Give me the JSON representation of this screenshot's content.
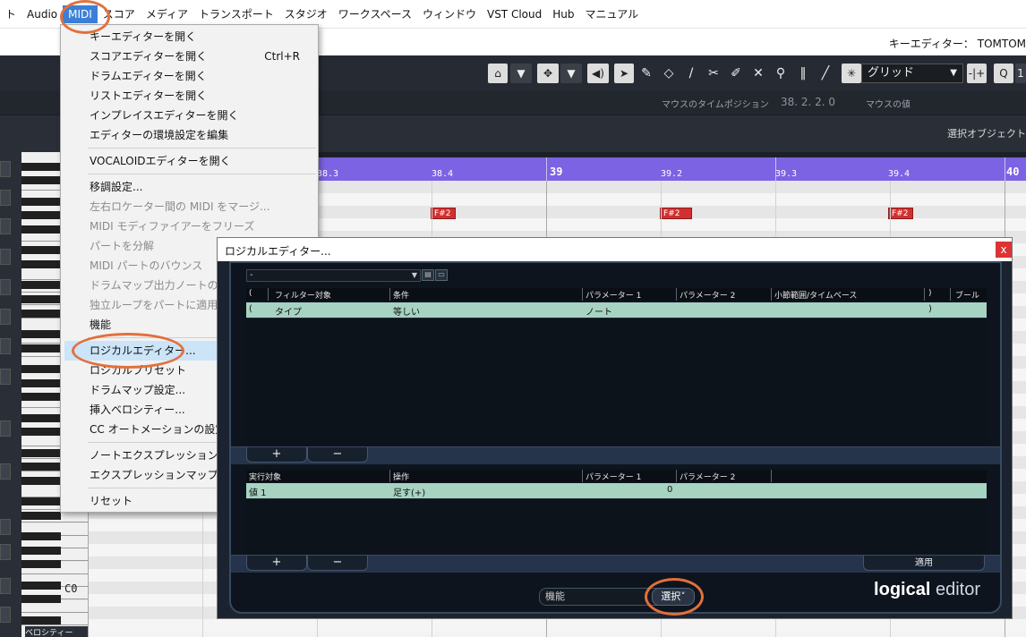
{
  "menubar": {
    "items": [
      "ト",
      "Audio",
      "MIDI",
      "スコア",
      "メディア",
      "トランスポート",
      "スタジオ",
      "ワークスペース",
      "ウィンドウ",
      "VST Cloud",
      "Hub",
      "マニュアル"
    ],
    "active": "MIDI"
  },
  "window": {
    "title": "キーエディター： TOMTOM"
  },
  "toolbar": {
    "grid_label": "グリッド",
    "quantize_label": "Q",
    "quantize_value": "1"
  },
  "infoline": {
    "mouse_time_label": "マウスのタイムポジション",
    "mouse_time_value": "38. 2. 2.   0",
    "mouse_value_label": "マウスの値"
  },
  "objline": {
    "selected_object_label": "選択オブジェクト"
  },
  "ruler": {
    "labels": [
      "38.3",
      "38.4",
      "39",
      "39.2",
      "39.3",
      "39.4",
      "40"
    ]
  },
  "notes": [
    "F#2",
    "F#2",
    "F#2"
  ],
  "keyboard": {
    "c0_label": "C0",
    "velocity_label": "ベロシティー"
  },
  "midi_menu": {
    "items": [
      {
        "label": "キーエディターを開く",
        "shortcut": ""
      },
      {
        "label": "スコアエディターを開く",
        "shortcut": "Ctrl+R"
      },
      {
        "label": "ドラムエディターを開く",
        "shortcut": ""
      },
      {
        "label": "リストエディターを開く",
        "shortcut": ""
      },
      {
        "label": "インプレイスエディターを開く",
        "shortcut": ""
      },
      {
        "label": "エディターの環境設定を編集",
        "shortcut": ""
      },
      {
        "label": "VOCALOIDエディターを開く",
        "shortcut": ""
      },
      {
        "label": "移調設定...",
        "shortcut": ""
      },
      {
        "label": "左右ロケーター間の MIDI をマージ...",
        "shortcut": ""
      },
      {
        "label": "MIDI モディファイアーをフリーズ",
        "shortcut": ""
      },
      {
        "label": "パートを分解",
        "shortcut": ""
      },
      {
        "label": "MIDI パートのバウンス",
        "shortcut": ""
      },
      {
        "label": "ドラムマップ出力ノートの変換",
        "shortcut": ""
      },
      {
        "label": "独立ループをパートに適用",
        "shortcut": ""
      },
      {
        "label": "機能",
        "shortcut": ""
      },
      {
        "label": "ロジカルエディター...",
        "shortcut": ""
      },
      {
        "label": "ロジカルプリセット",
        "shortcut": ""
      },
      {
        "label": "ドラムマップ設定...",
        "shortcut": ""
      },
      {
        "label": "挿入ベロシティー...",
        "shortcut": ""
      },
      {
        "label": "CC オートメーションの設定...",
        "shortcut": ""
      },
      {
        "label": "ノートエクスプレッション",
        "shortcut": ""
      },
      {
        "label": "エクスプレッションマップ設定...",
        "shortcut": ""
      },
      {
        "label": "リセット",
        "shortcut": ""
      }
    ]
  },
  "logical_editor": {
    "title": "ロジカルエディター...",
    "close_label": "x",
    "preset_value": "-",
    "filter_headers": [
      "(",
      "フィルター対象",
      "条件",
      "パラメーター 1",
      "パラメーター 2",
      "小節範囲/タイムベース",
      ")",
      "ブール"
    ],
    "filter_rows": [
      {
        "open": "(",
        "target": "タイプ",
        "condition": "等しい",
        "param1": "ノート",
        "param2": "",
        "bar_range": "",
        "close": ")",
        "bool": ""
      }
    ],
    "action_headers": [
      "実行対象",
      "操作",
      "パラメーター 1",
      "パラメーター 2"
    ],
    "action_rows": [
      {
        "target": "値 1",
        "operation": "足す(+)",
        "param1": "0",
        "param2": ""
      }
    ],
    "add_label": "+",
    "remove_label": "−",
    "apply_label": "適用",
    "function_value": "機能",
    "execute_label": "選択",
    "logo_bold": "logical",
    "logo_light": " editor"
  }
}
